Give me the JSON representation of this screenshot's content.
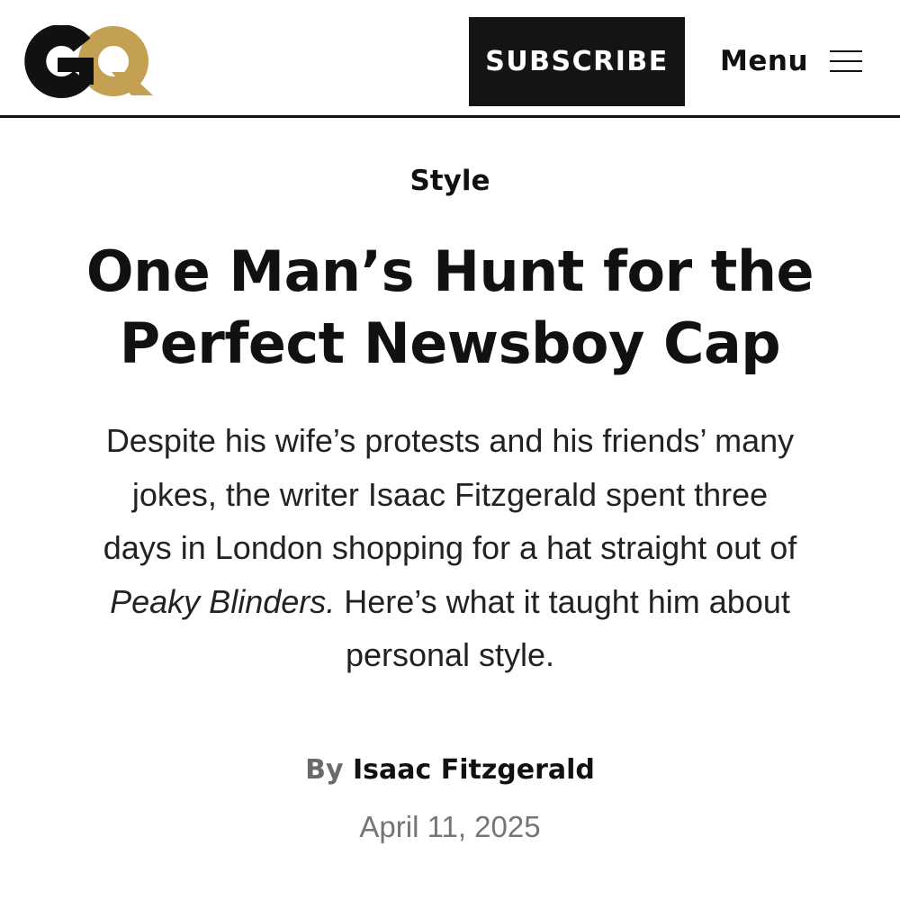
{
  "site": {
    "logo_text": "GQ",
    "colors": {
      "logo_g": "#111111",
      "logo_q": "#c4a053",
      "subscribe_bg": "#141414"
    }
  },
  "header": {
    "subscribe_label": "SUBSCRIBE",
    "menu_label": "Menu",
    "menu_icon": "hamburger-icon"
  },
  "article": {
    "rubric": "Style",
    "headline_line1": "One Man’s Hunt for the",
    "headline_line2": "Perfect Newsboy Cap",
    "dek": {
      "line1": "Despite his wife’s protests and his friends’ many",
      "line2": "jokes, the writer Isaac Fitzgerald spent three",
      "line3": "days in London shopping for a hat straight out of",
      "line4_italic": "Peaky Blinders.",
      "line4_rest": " Here’s what it taught him about",
      "line5": "personal style."
    },
    "byline_prefix": "By",
    "author": "Isaac Fitzgerald",
    "date": "April 11, 2025"
  }
}
